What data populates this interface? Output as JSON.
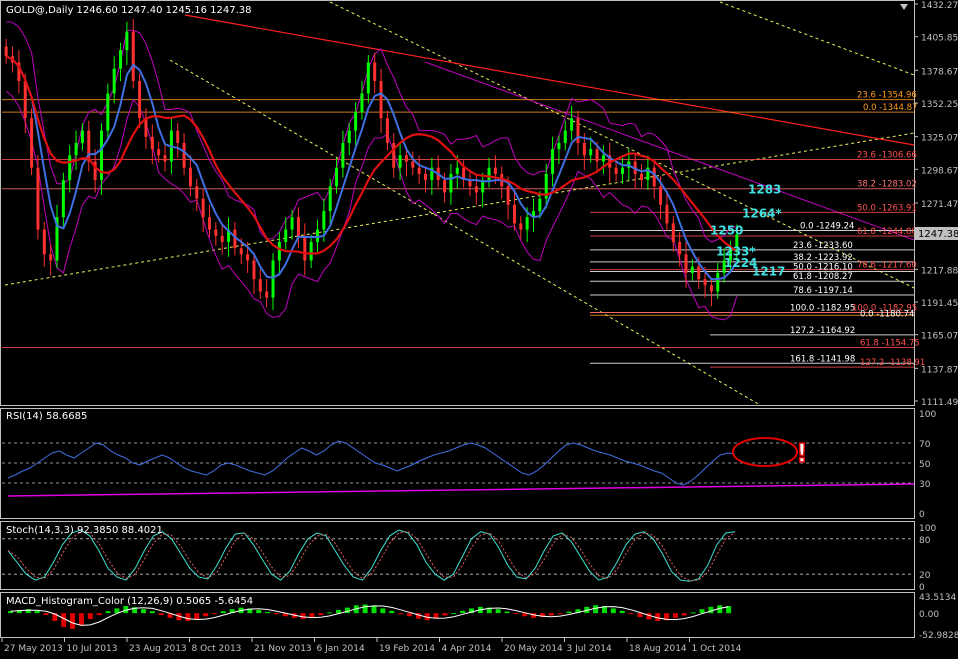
{
  "header": {
    "title": "GOLD@,Daily  1246.60 1247.40 1245.16 1247.38",
    "rsi_title": "RSI(14) 58.6685",
    "stoch_title": "Stoch(14,3,3) 92.3850 88.4021",
    "macd_title": "MACD_Histogram_Color (12,26,9) 0.5065 -5.6454"
  },
  "colors": {
    "bg": "#000000",
    "axis": "#c0c0c0",
    "candle_up": "#00ff00",
    "candle_down": "#ff3030",
    "ma_blue": "#3f6fe0",
    "ma_red": "#e01010",
    "bollinger": "#c000c0",
    "trend_yellow": "#f0f060",
    "fib_orange": "#ff9a20",
    "label_cyan": "#40e0e0",
    "rsi_line": "#3f6fe0",
    "rsi_trend": "#e000e0",
    "stoch_line": "#40e0d0",
    "macd_pos": "#00e000",
    "macd_neg": "#e00000",
    "marker_red": "#e00000"
  },
  "chart_data": [
    {
      "type": "candlestick",
      "panel": "price",
      "symbol": "GOLD@",
      "timeframe": "Daily",
      "ylim": [
        1111.49,
        1432.27
      ],
      "y_ticks": [
        "1432.27",
        "1405.85",
        "1378.67",
        "1352.25",
        "1325.07",
        "1298.67",
        "1271.47",
        "1247.38",
        "1217.88",
        "1191.45",
        "1165.07",
        "1137.87",
        "1111.49"
      ],
      "current_price": "1247.38",
      "x_ticks": [
        "27 May 2013",
        "10 Jul 2013",
        "23 Aug 2013",
        "8 Oct 2013",
        "21 Nov 2013",
        "6 Jan 2014",
        "19 Feb 2014",
        "4 Apr 2014",
        "20 May 2014",
        "3 Jul 2014",
        "18 Aug 2014",
        "1 Oct 2014"
      ],
      "closes": [
        1390,
        1385,
        1370,
        1340,
        1300,
        1250,
        1230,
        1225,
        1260,
        1290,
        1310,
        1320,
        1330,
        1305,
        1290,
        1330,
        1360,
        1380,
        1395,
        1410,
        1370,
        1340,
        1325,
        1315,
        1310,
        1305,
        1330,
        1320,
        1300,
        1285,
        1275,
        1260,
        1250,
        1245,
        1240,
        1250,
        1235,
        1230,
        1225,
        1210,
        1200,
        1195,
        1225,
        1240,
        1250,
        1260,
        1245,
        1225,
        1240,
        1250,
        1265,
        1285,
        1300,
        1320,
        1330,
        1345,
        1360,
        1385,
        1370,
        1340,
        1320,
        1300,
        1310,
        1305,
        1300,
        1295,
        1290,
        1300,
        1290,
        1280,
        1295,
        1300,
        1290,
        1285,
        1280,
        1290,
        1300,
        1295,
        1285,
        1270,
        1255,
        1250,
        1260,
        1265,
        1275,
        1295,
        1315,
        1320,
        1330,
        1340,
        1320,
        1310,
        1315,
        1305,
        1310,
        1300,
        1295,
        1300,
        1305,
        1295,
        1290,
        1300,
        1285,
        1270,
        1255,
        1240,
        1230,
        1215,
        1220,
        1210,
        1205,
        1200,
        1215,
        1225,
        1235,
        1246
      ],
      "fib_levels": [
        {
          "label": "23.6 -1354.96",
          "value": 1354.96
        },
        {
          "label": "0.0 -1344.87",
          "value": 1344.87
        },
        {
          "label": "23.6 -1306.66",
          "value": 1306.66
        },
        {
          "label": "38.2 -1283.02",
          "value": 1283.02
        },
        {
          "label": "50.0 -1263.91",
          "value": 1263.91
        },
        {
          "label": "61.8 -1244.80",
          "value": 1244.8
        },
        {
          "label": "0.0 -1249.24",
          "value": 1249.24
        },
        {
          "label": "23.6 -1233.60",
          "value": 1233.6
        },
        {
          "label": "38.2 -1223.92",
          "value": 1223.92
        },
        {
          "label": "50.0 -1216.10",
          "value": 1216.1
        },
        {
          "label": "78.6 -1217.60",
          "value": 1217.6
        },
        {
          "label": "61.8 -1208.27",
          "value": 1208.27
        },
        {
          "label": "78.6 -1197.14",
          "value": 1197.14
        },
        {
          "label": "100.0 -1182.95",
          "value": 1182.95
        },
        {
          "label": "100.0 -1182.95",
          "value": 1182.95
        },
        {
          "label": "0.0 -1180.74",
          "value": 1180.74
        },
        {
          "label": "127.2 -1164.92",
          "value": 1164.92
        },
        {
          "label": "61.8 -1154.75",
          "value": 1154.75
        },
        {
          "label": "161.8 -1141.98",
          "value": 1141.98
        },
        {
          "label": "127.2 -1138.91",
          "value": 1138.91
        }
      ],
      "annotations": [
        {
          "text": "1283",
          "value": 1283
        },
        {
          "text": "1264*",
          "value": 1264
        },
        {
          "text": "1250",
          "value": 1250
        },
        {
          "text": "1233*",
          "value": 1233
        },
        {
          "text": "1224",
          "value": 1224
        },
        {
          "text": "1217",
          "value": 1217
        }
      ]
    },
    {
      "type": "line",
      "panel": "rsi",
      "name": "RSI(14)",
      "current": 58.6685,
      "ylim": [
        0,
        100
      ],
      "y_ticks": [
        "100",
        "70",
        "50",
        "30",
        "0"
      ],
      "values": [
        35,
        38,
        42,
        45,
        50,
        55,
        60,
        62,
        58,
        55,
        60,
        65,
        70,
        68,
        62,
        58,
        55,
        50,
        48,
        52,
        55,
        58,
        55,
        50,
        45,
        42,
        40,
        38,
        42,
        48,
        50,
        48,
        45,
        42,
        40,
        38,
        42,
        48,
        55,
        60,
        65,
        62,
        58,
        62,
        68,
        72,
        70,
        65,
        60,
        55,
        50,
        48,
        45,
        42,
        45,
        48,
        52,
        55,
        58,
        60,
        62,
        65,
        68,
        70,
        68,
        65,
        60,
        55,
        50,
        45,
        40,
        38,
        42,
        48,
        55,
        62,
        68,
        70,
        68,
        65,
        62,
        60,
        58,
        55,
        52,
        50,
        48,
        45,
        42,
        40,
        35,
        30,
        28,
        32,
        38,
        45,
        52,
        58,
        60,
        59
      ]
    },
    {
      "type": "line",
      "panel": "stochastic",
      "name": "Stoch(14,3,3)",
      "current": [
        92.385,
        88.4021
      ],
      "ylim": [
        0,
        100
      ],
      "y_ticks": [
        "100",
        "80",
        "20",
        "0"
      ],
      "values": [
        60,
        40,
        20,
        10,
        15,
        40,
        70,
        90,
        95,
        85,
        60,
        30,
        15,
        10,
        30,
        60,
        85,
        92,
        80,
        55,
        30,
        15,
        12,
        35,
        65,
        88,
        90,
        70,
        45,
        20,
        10,
        25,
        55,
        80,
        90,
        85,
        60,
        35,
        15,
        10,
        30,
        60,
        85,
        95,
        90,
        70,
        40,
        20,
        10,
        20,
        50,
        80,
        92,
        88,
        65,
        35,
        15,
        12,
        30,
        60,
        85,
        90,
        75,
        50,
        25,
        10,
        15,
        40,
        70,
        88,
        92,
        80,
        55,
        25,
        10,
        8,
        12,
        35,
        70,
        90,
        92
      ]
    },
    {
      "type": "bar",
      "panel": "macd",
      "name": "MACD_Histogram_Color (12,26,9)",
      "current": [
        0.5065,
        -5.6454
      ],
      "ylim": [
        -52.9828,
        43.5134
      ],
      "y_ticks": [
        "43.5134",
        "0.00",
        "-52.9828"
      ],
      "values": [
        5,
        8,
        10,
        6,
        -5,
        -20,
        -35,
        -40,
        -30,
        -15,
        -5,
        5,
        12,
        18,
        15,
        10,
        5,
        -5,
        -12,
        -18,
        -20,
        -15,
        -8,
        -2,
        5,
        10,
        14,
        12,
        8,
        3,
        -3,
        -8,
        -12,
        -15,
        -10,
        -5,
        2,
        8,
        14,
        20,
        22,
        18,
        12,
        6,
        -2,
        -8,
        -14,
        -18,
        -12,
        -6,
        0,
        6,
        12,
        16,
        14,
        10,
        4,
        -2,
        -8,
        -12,
        -10,
        -6,
        -2,
        4,
        10,
        16,
        20,
        18,
        12,
        6,
        -2,
        -10,
        -16,
        -20,
        -18,
        -12,
        -6,
        2,
        10,
        16,
        20,
        18
      ]
    }
  ]
}
